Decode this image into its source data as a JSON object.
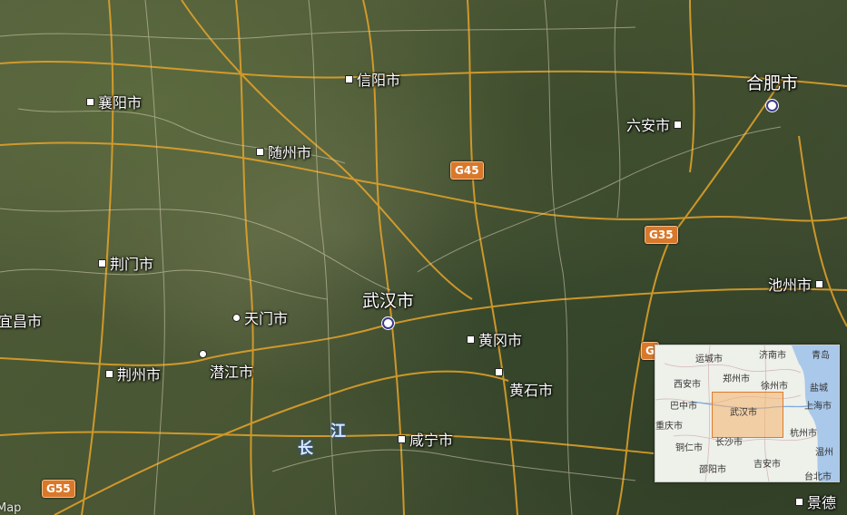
{
  "map": {
    "cities": [
      {
        "id": "xinyang",
        "name": "信阳市",
        "marker": "square"
      },
      {
        "id": "hefei",
        "name": "合肥市",
        "marker": "capital"
      },
      {
        "id": "xiangyang",
        "name": "襄阳市",
        "marker": "square"
      },
      {
        "id": "liuan",
        "name": "六安市",
        "marker": "square"
      },
      {
        "id": "suizhou",
        "name": "随州市",
        "marker": "square"
      },
      {
        "id": "jingmen",
        "name": "荆门市",
        "marker": "square"
      },
      {
        "id": "chizhou",
        "name": "池州市",
        "marker": "square"
      },
      {
        "id": "wuhan",
        "name": "武汉市",
        "marker": "capital"
      },
      {
        "id": "tianmen",
        "name": "天门市",
        "marker": "round"
      },
      {
        "id": "yichang",
        "name": "宜昌市",
        "marker": "square"
      },
      {
        "id": "huanggang",
        "name": "黄冈市",
        "marker": "square"
      },
      {
        "id": "jingzhou",
        "name": "荆州市",
        "marker": "square"
      },
      {
        "id": "qianjiang",
        "name": "潜江市",
        "marker": "round"
      },
      {
        "id": "huangshi",
        "name": "黄石市",
        "marker": "square"
      },
      {
        "id": "xianning",
        "name": "咸宁市",
        "marker": "square"
      },
      {
        "id": "jingdezhen",
        "name": "景德",
        "marker": "square"
      }
    ],
    "highways": [
      "G45",
      "G35",
      "G",
      "G55"
    ],
    "river": [
      "长",
      "江"
    ],
    "watermark": "Map"
  },
  "overview": {
    "cities": [
      "运城市",
      "济南市",
      "青岛",
      "西安市",
      "郑州市",
      "盐城",
      "徐州市",
      "巴中市",
      "上海市",
      "重庆市",
      "杭州市",
      "铜仁市",
      "长沙市",
      "温州",
      "邵阳市",
      "吉安市",
      "台北市"
    ],
    "viewport_label": "武汉市"
  },
  "colors": {
    "highway": "#e6a42a",
    "road": "#d9d3b8",
    "shield": "#d9782b",
    "viewport": "#f6b26b"
  }
}
